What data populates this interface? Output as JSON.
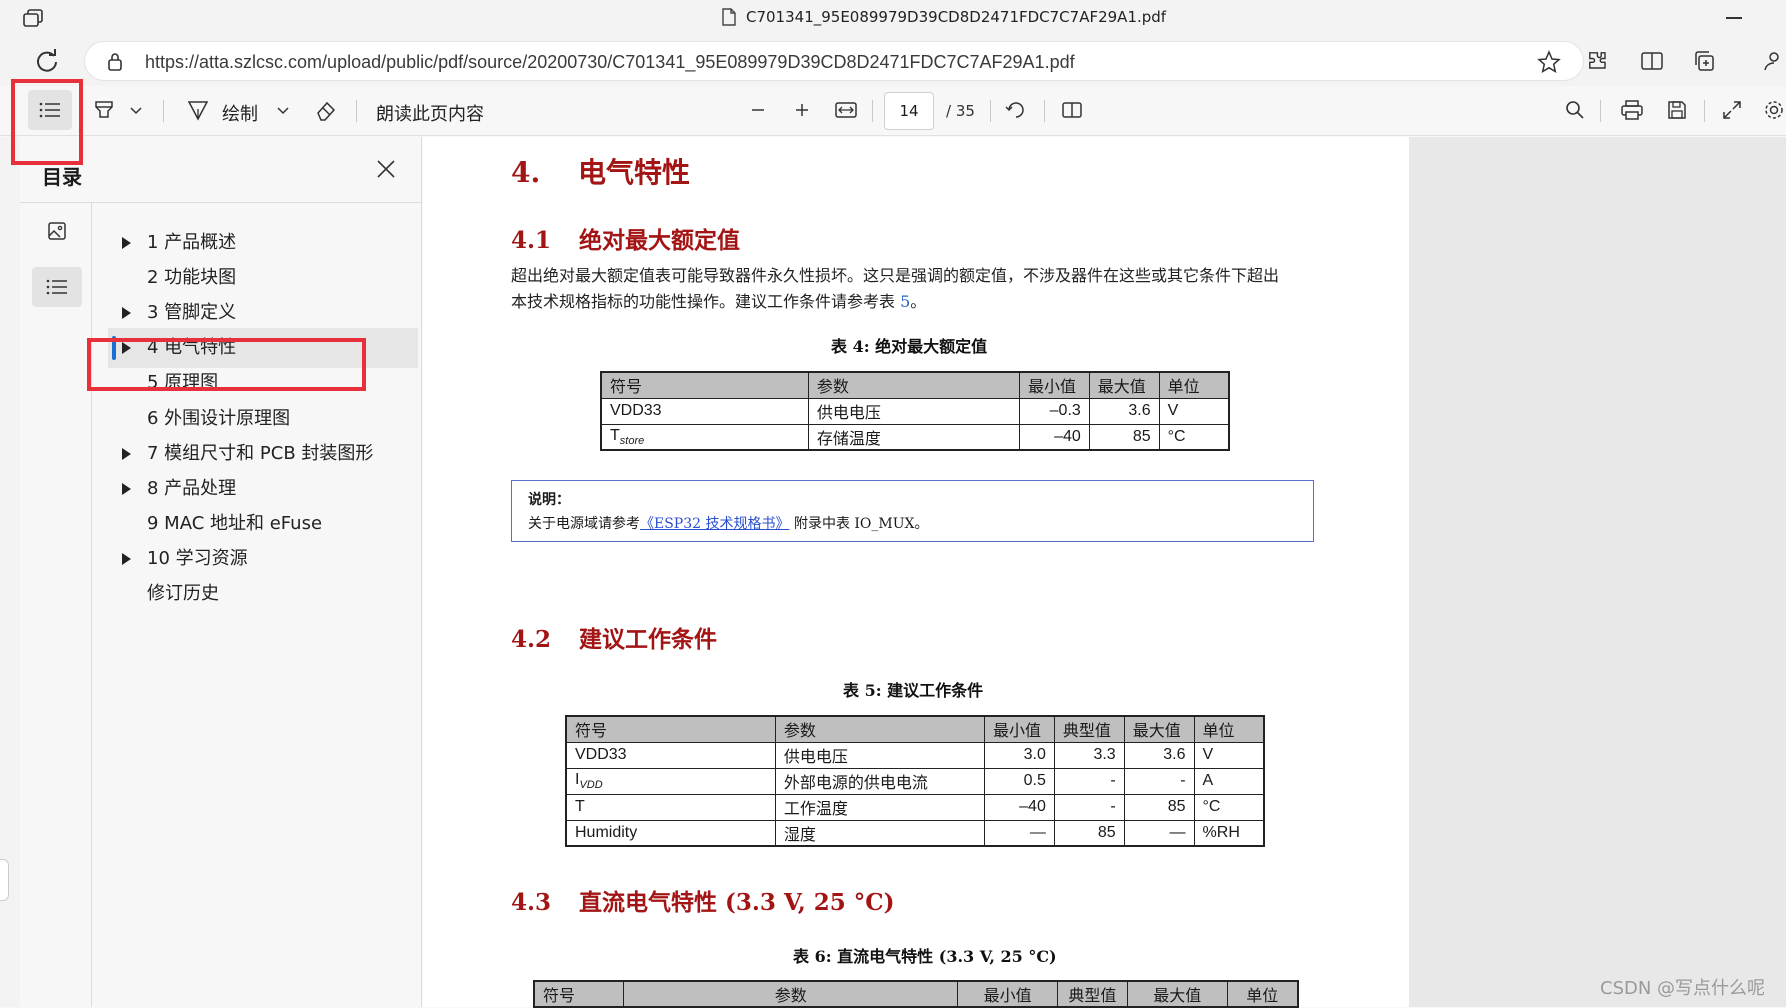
{
  "window": {
    "title": "C701341_95E089979D39CD8D2471FDC7C7AF29A1.pdf"
  },
  "address_bar": {
    "url": "https://atta.szlcsc.com/upload/public/pdf/source/20200730/C701341_95E089979D39CD8D2471FDC7C7AF29A1.pdf"
  },
  "pdf_toolbar": {
    "draw_label": "绘制",
    "read_aloud_label": "朗读此页内容",
    "page_number": "14",
    "page_total": "/ 35"
  },
  "sidebar": {
    "title": "目录",
    "toc": [
      {
        "label": "1 产品概述",
        "expandable": true,
        "active": false
      },
      {
        "label": "2 功能块图",
        "expandable": false,
        "active": false
      },
      {
        "label": "3 管脚定义",
        "expandable": true,
        "active": false
      },
      {
        "label": "4 电气特性",
        "expandable": true,
        "active": true
      },
      {
        "label": "5 原理图",
        "expandable": false,
        "active": false
      },
      {
        "label": "6 外围设计原理图",
        "expandable": false,
        "active": false
      },
      {
        "label": "7 模组尺寸和 PCB 封装图形",
        "expandable": true,
        "active": false
      },
      {
        "label": "8 产品处理",
        "expandable": true,
        "active": false
      },
      {
        "label": "9 MAC 地址和 eFuse",
        "expandable": false,
        "active": false
      },
      {
        "label": "10 学习资源",
        "expandable": true,
        "active": false
      },
      {
        "label": "修订历史",
        "expandable": false,
        "active": false
      }
    ]
  },
  "document": {
    "section4": {
      "num": "4.",
      "title": "电气特性"
    },
    "section41": {
      "num": "4.1",
      "title": "绝对最大额定值",
      "para_line1": "超出绝对最大额定值表可能导致器件永久性损坏。这只是强调的额定值，不涉及器件在这些或其它条件下超出",
      "para_line2": "本技术规格指标的功能性操作。建议工作条件请参考表 ",
      "para_ref": "5",
      "para_end": "。",
      "table_caption": "表 4: 绝对最大额定值",
      "table_headers": [
        "符号",
        "参数",
        "最小值",
        "最大值",
        "单位"
      ],
      "table_rows": [
        {
          "sym": "VDD33",
          "sub": "",
          "param": "供电电压",
          "min": "–0.3",
          "max": "3.6",
          "unit": "V"
        },
        {
          "sym": "T",
          "sub": "store",
          "param": "存储温度",
          "min": "–40",
          "max": "85",
          "unit": "°C"
        }
      ]
    },
    "note": {
      "title": "说明：",
      "prefix": "关于电源域请参考",
      "link": "《ESP32 技术规格书》",
      "suffix": " 附录中表 IO_MUX。"
    },
    "section42": {
      "num": "4.2",
      "title": "建议工作条件",
      "table_caption": "表 5: 建议工作条件",
      "table_headers": [
        "符号",
        "参数",
        "最小值",
        "典型值",
        "最大值",
        "单位"
      ],
      "table_rows": [
        {
          "sym": "VDD33",
          "sub": "",
          "param": "供电电压",
          "min": "3.0",
          "typ": "3.3",
          "max": "3.6",
          "unit": "V"
        },
        {
          "sym": "I",
          "sub": "VDD",
          "param": "外部电源的供电电流",
          "min": "0.5",
          "typ": "-",
          "max": "-",
          "unit": "A"
        },
        {
          "sym": "T",
          "sub": "",
          "param": "工作温度",
          "min": "–40",
          "typ": "-",
          "max": "85",
          "unit": "°C"
        },
        {
          "sym": "Humidity",
          "sub": "",
          "param": "湿度",
          "min": "—",
          "typ": "85",
          "max": "—",
          "unit": "%RH"
        }
      ]
    },
    "section43": {
      "num": "4.3",
      "title": "直流电气特性 (3.3 V, 25 °C)",
      "table_caption": "表 6: 直流电气特性 (3.3 V, 25 °C)",
      "table_headers": [
        "符号",
        "参数",
        "最小值",
        "典型值",
        "最大值",
        "单位"
      ]
    }
  },
  "watermark": "CSDN @写点什么呢"
}
